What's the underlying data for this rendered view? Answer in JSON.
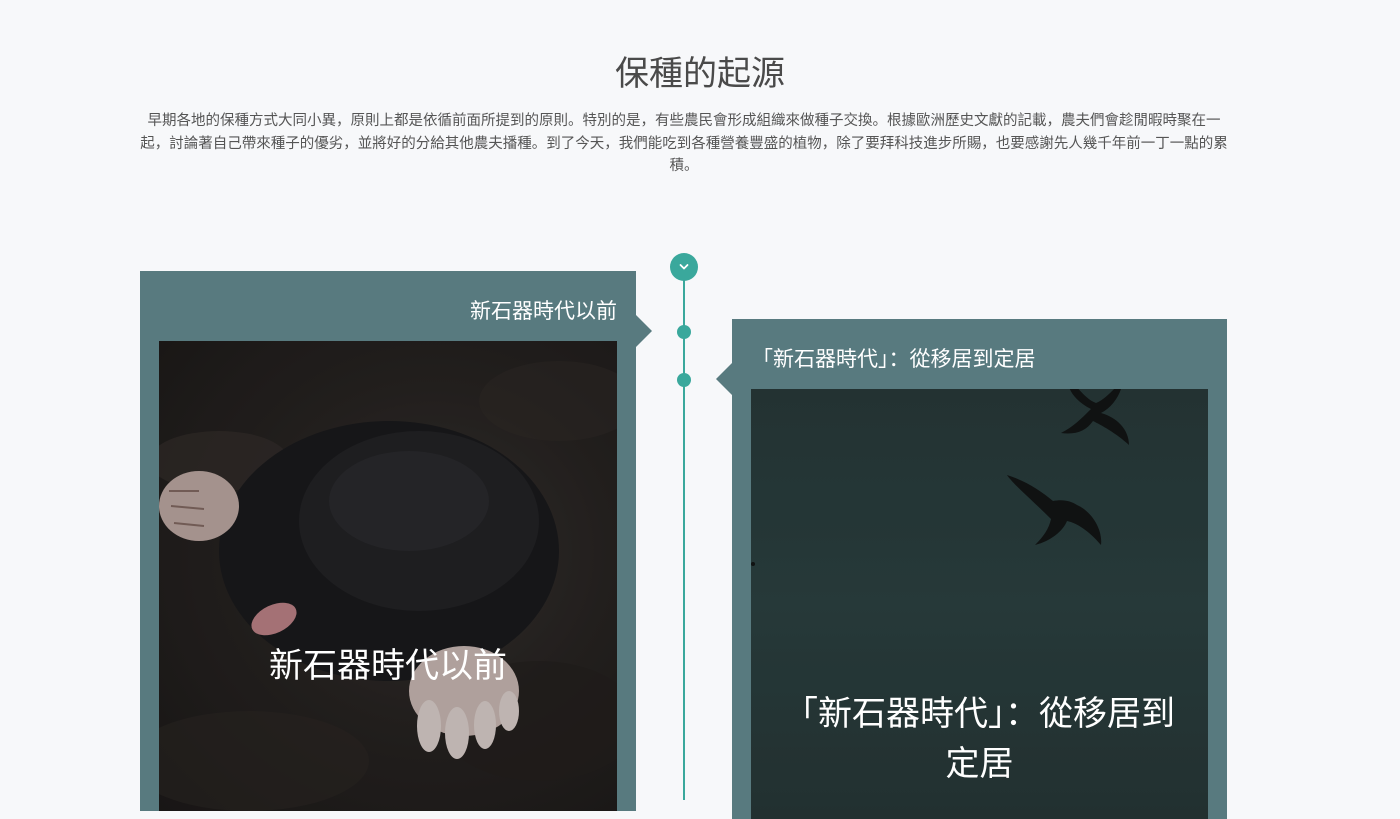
{
  "section": {
    "title": "保種的起源",
    "intro": "早期各地的保種方式大同小異，原則上都是依循前面所提到的原則。特別的是，有些農民會形成組織來做種子交換。根據歐洲歷史文獻的記載，農夫們會趁閒暇時聚在一起，討論著自己帶來種子的優劣，並將好的分給其他農夫播種。到了今天，我們能吃到各種營養豐盛的植物，除了要拜科技進步所賜，也要感謝先人幾千年前一丁一點的累積。"
  },
  "timeline": {
    "toggle_icon": "chevron-down-icon",
    "accent_color": "#3aa89c",
    "card_color": "#587a7f",
    "cards": [
      {
        "heading": "新石器時代以前",
        "caption": "新石器時代以前"
      },
      {
        "heading": "「新石器時代」：從移居到定居",
        "caption": "「新石器時代」：從移居到定居"
      }
    ]
  }
}
